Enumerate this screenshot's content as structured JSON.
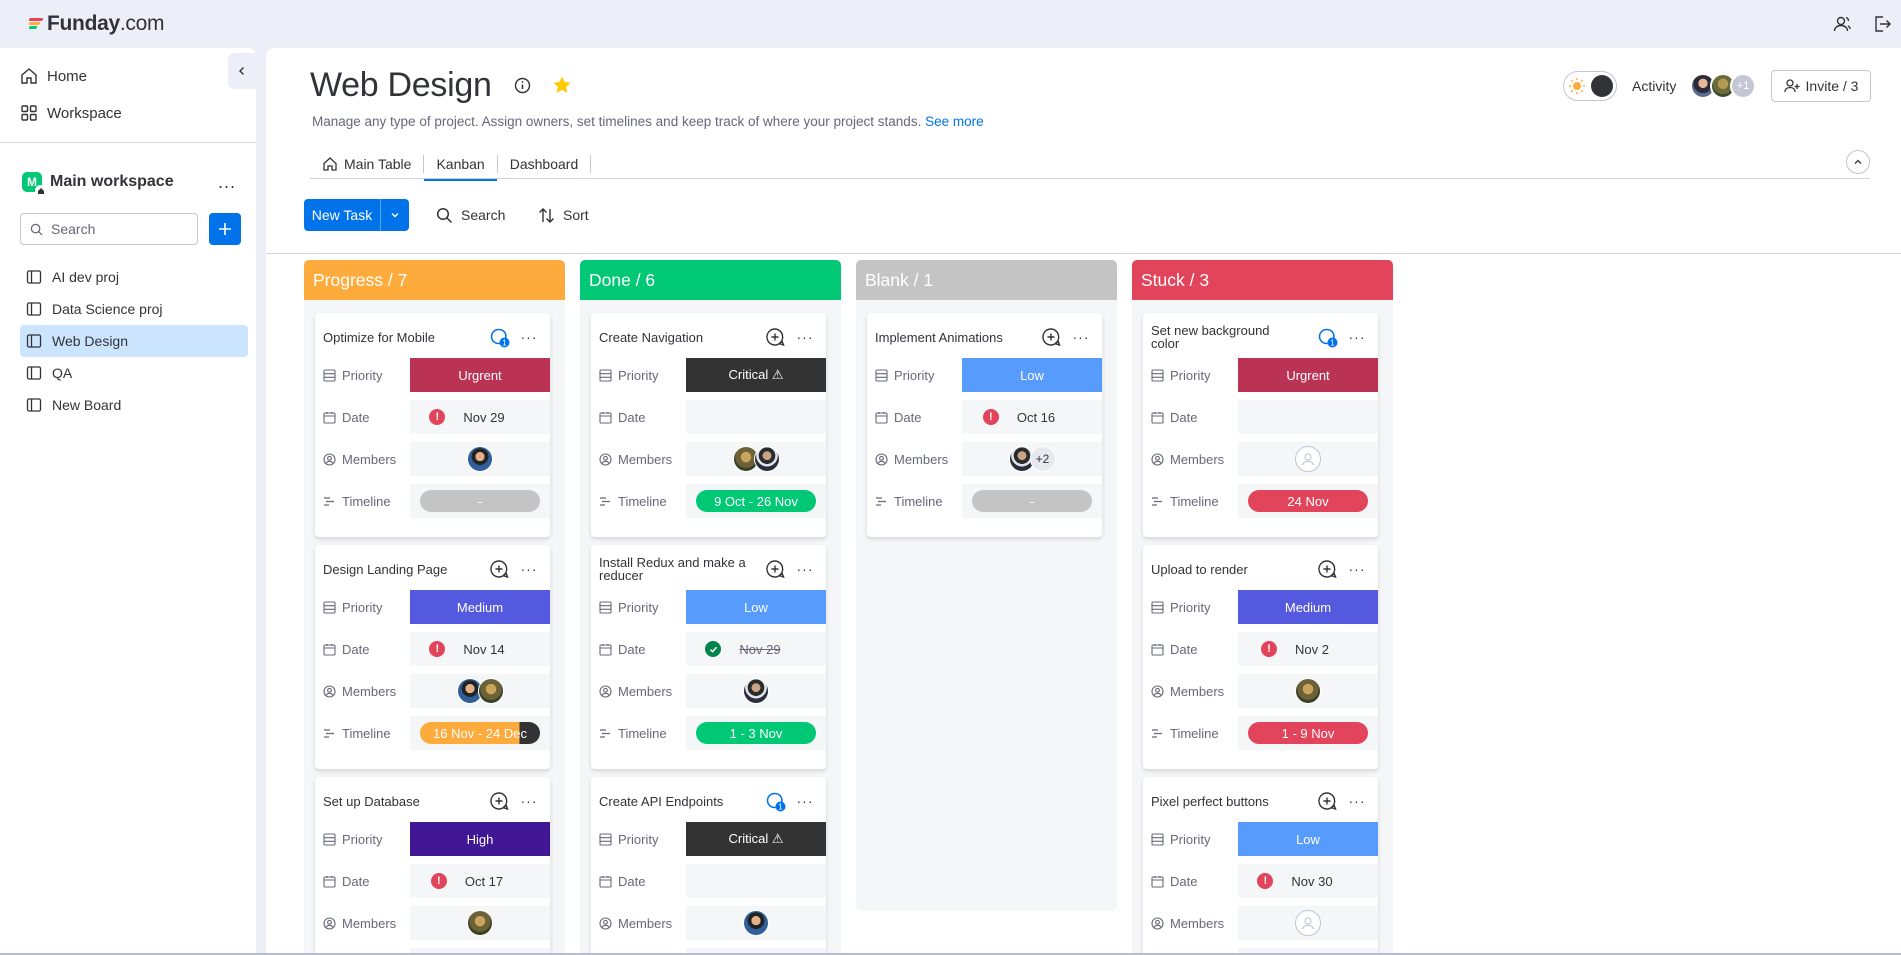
{
  "brand": {
    "name": "Funday",
    "suffix": ".com"
  },
  "sidebar": {
    "nav": [
      {
        "label": "Home",
        "icon": "home-icon"
      },
      {
        "label": "Workspace",
        "icon": "workspace-icon"
      }
    ],
    "workspace": {
      "badge": "M",
      "name": "Main workspace",
      "more": "..."
    },
    "search_placeholder": "Search",
    "boards": [
      {
        "label": "AI dev proj",
        "active": false
      },
      {
        "label": "Data Science proj",
        "active": false
      },
      {
        "label": "Web Design",
        "active": true
      },
      {
        "label": "QA",
        "active": false
      },
      {
        "label": "New Board",
        "active": false
      }
    ]
  },
  "header": {
    "title": "Web Design",
    "description": "Manage any type of project. Assign owners, set timelines and keep track of where your project stands.",
    "see_more": "See more",
    "activity_label": "Activity",
    "activity_more": "+1",
    "invite_label": "Invite / 3",
    "tabs": [
      {
        "label": "Main Table",
        "active": false
      },
      {
        "label": "Kanban",
        "active": true
      },
      {
        "label": "Dashboard",
        "active": false
      }
    ]
  },
  "toolbar": {
    "new_task": "New Task",
    "search": "Search",
    "sort": "Sort"
  },
  "labels": {
    "priority": "Priority",
    "date": "Date",
    "members": "Members",
    "timeline": "Timeline"
  },
  "colors": {
    "progress": "#fdab3d",
    "done": "#00c875",
    "blank": "#c4c4c4",
    "stuck": "#e2445c",
    "urgent": "#bb3354",
    "critical": "#333333",
    "low": "#579bfc",
    "medium": "#5559df",
    "high": "#401694",
    "accent": "#0073ea"
  },
  "columns": [
    {
      "title": "Progress / 7",
      "color": "#fdab3d",
      "cards": [
        {
          "name": "Optimize for Mobile",
          "updates": "1",
          "priority": "Urgrent",
          "priority_color": "#bb3354",
          "date": "Nov 29",
          "date_state": "alert",
          "members": [
            "a1"
          ],
          "timeline": "-",
          "timeline_color": "#c4c4c4"
        },
        {
          "name": "Design Landing Page",
          "updates": "",
          "priority": "Medium",
          "priority_color": "#5559df",
          "date": "Nov 14",
          "date_state": "alert",
          "members": [
            "a1",
            "a2"
          ],
          "timeline": "16 Nov - 24 Dec",
          "timeline_color": "split"
        },
        {
          "name": "Set up Database",
          "updates": "",
          "priority": "High",
          "priority_color": "#401694",
          "date": "Oct 17",
          "date_state": "alert",
          "members": [
            "a2"
          ],
          "timeline": "",
          "timeline_color": ""
        }
      ]
    },
    {
      "title": "Done / 6",
      "color": "#00c875",
      "cards": [
        {
          "name": "Create Navigation",
          "updates": "",
          "priority": "Critical ⚠",
          "priority_color": "#333333",
          "date": "",
          "date_state": "none",
          "members": [
            "a2",
            "a3"
          ],
          "timeline": "9 Oct - 26 Nov",
          "timeline_color": "#00c875"
        },
        {
          "name": "Install Redux and make a reducer",
          "updates": "",
          "priority": "Low",
          "priority_color": "#579bfc",
          "date": "Nov 29",
          "date_state": "done",
          "members": [
            "a3"
          ],
          "timeline": "1 - 3 Nov",
          "timeline_color": "#00c875"
        },
        {
          "name": "Create API Endpoints",
          "updates": "1",
          "priority": "Critical ⚠",
          "priority_color": "#333333",
          "date": "",
          "date_state": "none",
          "members": [
            "a1"
          ],
          "timeline": "",
          "timeline_color": ""
        }
      ]
    },
    {
      "title": "Blank / 1",
      "color": "#c4c4c4",
      "cards": [
        {
          "name": "Implement Animations",
          "updates": "",
          "priority": "Low",
          "priority_color": "#579bfc",
          "date": "Oct 16",
          "date_state": "alert",
          "members": [
            "a3",
            "+2"
          ],
          "timeline": "-",
          "timeline_color": "#c4c4c4"
        }
      ]
    },
    {
      "title": "Stuck / 3",
      "color": "#e2445c",
      "cards": [
        {
          "name": "Set new background color",
          "updates": "1",
          "priority": "Urgrent",
          "priority_color": "#bb3354",
          "date": "",
          "date_state": "none",
          "members": [
            "empty"
          ],
          "timeline": "24 Nov",
          "timeline_color": "#e2445c"
        },
        {
          "name": "Upload to render",
          "updates": "",
          "priority": "Medium",
          "priority_color": "#5559df",
          "date": "Nov 2",
          "date_state": "alert",
          "members": [
            "a2"
          ],
          "timeline": "1 - 9 Nov",
          "timeline_color": "#e2445c"
        },
        {
          "name": "Pixel perfect buttons",
          "updates": "",
          "priority": "Low",
          "priority_color": "#579bfc",
          "date": "Nov 30",
          "date_state": "alert",
          "members": [
            "empty"
          ],
          "timeline": "",
          "timeline_color": ""
        }
      ]
    }
  ]
}
